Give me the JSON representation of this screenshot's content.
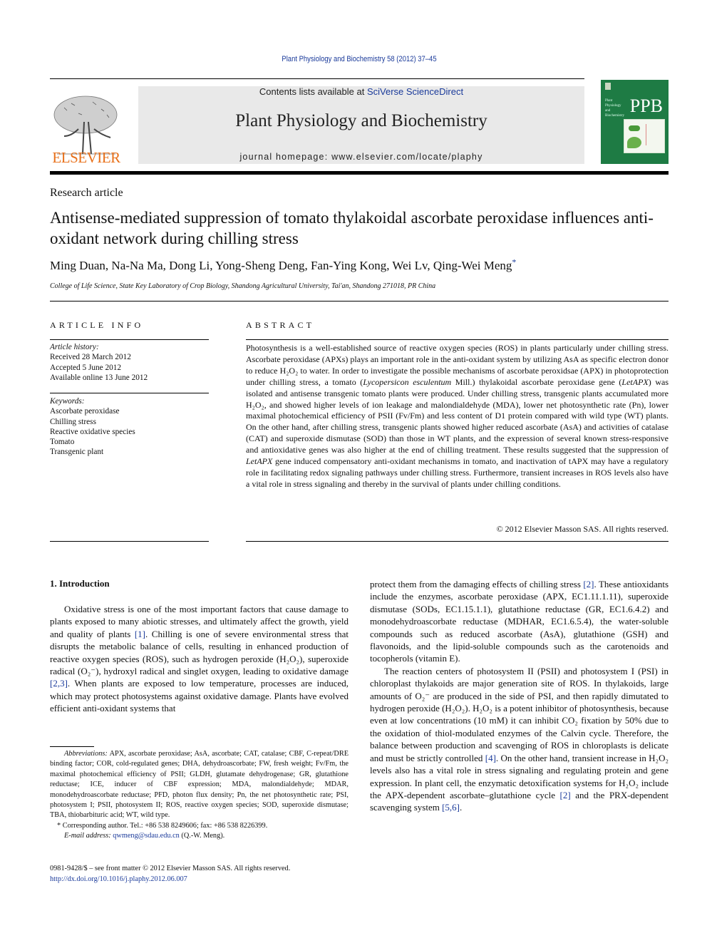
{
  "header": {
    "running_head": "Plant Physiology and Biochemistry 58 (2012) 37–45",
    "contents_prefix": "Contents lists available at ",
    "contents_link": "SciVerse ScienceDirect",
    "journal_name": "Plant Physiology and Biochemistry",
    "homepage_prefix": "journal homepage: ",
    "homepage_url": "www.elsevier.com/locate/plaphy",
    "publisher_logo_text": "ELSEVIER",
    "cover_title": "PPB",
    "cover_small_text": "Plant Physiology and Biochemistry",
    "colors": {
      "publisher_orange": "#e8701a",
      "cover_green": "#1e7b44",
      "link_blue": "#1a3a9a",
      "masthead_gray": "#e9e9e9"
    }
  },
  "article": {
    "type": "Research article",
    "title": "Antisense-mediated suppression of tomato thylakoidal ascorbate peroxidase influences anti-oxidant network during chilling stress",
    "authors": "Ming Duan, Na-Na Ma, Dong Li, Yong-Sheng Deng, Fan-Ying Kong, Wei Lv, Qing-Wei Meng",
    "corresponding_mark": "*",
    "affiliation": "College of Life Science, State Key Laboratory of Crop Biology, Shandong Agricultural University, Tai'an, Shandong 271018, PR China"
  },
  "article_info": {
    "heading": "ARTICLE INFO",
    "history_label": "Article history:",
    "history": [
      "Received 28 March 2012",
      "Accepted 5 June 2012",
      "Available online 13 June 2012"
    ],
    "keywords_label": "Keywords:",
    "keywords": [
      "Ascorbate peroxidase",
      "Chilling stress",
      "Reactive oxidative species",
      "Tomato",
      "Transgenic plant"
    ]
  },
  "abstract": {
    "heading": "ABSTRACT",
    "p1": "Photosynthesis is a well-established source of reactive oxygen species (ROS) in plants particularly under chilling stress. Ascorbate peroxidase (APXs) plays an important role in the anti-oxidant system by utilizing AsA as specific electron donor to reduce ",
    "h2o2": "H₂O₂",
    "p2": " to water. In order to investigate the possible mechanisms of ascorbate peroxidsae (APX) in photoprotection under chilling stress, a tomato (",
    "species": "Lycopersicon esculentum",
    "p3": " Mill.) thylakoidal ascorbate peroxidase gene (",
    "gene": "LetAPX",
    "p4": ") was isolated and antisense transgenic tomato plants were produced. Under chilling stress, transgenic plants accumulated more ",
    "p5": ", and showed higher levels of ion leakage and malondialdehyde (MDA), lower net photosynthetic rate (Pn), lower maximal photochemical efficiency of PSII (Fv/Fm) and less content of D1 protein compared with wild type (WT) plants. On the other hand, after chilling stress, transgenic plants showed higher reduced ascorbate (AsA) and activities of catalase (CAT) and superoxide dismutase (SOD) than those in WT plants, and the expression of several known stress-responsive and antioxidative genes was also higher at the end of chilling treatment. These results suggested that the suppression of ",
    "p6": " gene induced compensatory anti-oxidant mechanisms in tomato, and inactivation of tAPX may have a regulatory role in facilitating redox signaling pathways under chilling stress. Furthermore, transient increases in ROS levels also have a vital role in stress signaling and thereby in the survival of plants under chilling conditions.",
    "copyright": "© 2012 Elsevier Masson SAS. All rights reserved."
  },
  "introduction": {
    "heading": "1.  Introduction",
    "left_p1_a": "Oxidative stress is one of the most important factors that cause damage to plants exposed to many abiotic stresses, and ultimately affect the growth, yield and quality of plants ",
    "cite1": "[1]",
    "left_p1_b": ". Chilling is one of severe environmental stress that disrupts the metabolic balance of cells, resulting in enhanced production of reactive oxygen species (ROS), such as hydrogen peroxide (H₂O₂), superoxide radical (O₂⁻), hydroxyl radical and singlet oxygen, leading to oxidative damage ",
    "cite23": "[2,3]",
    "left_p1_c": ". When plants are exposed to low temperature, processes are induced, which may protect photosystems against oxidative damage. Plants have evolved efficient anti-oxidant systems that",
    "right_p1_a": "protect them from the damaging effects of chilling stress ",
    "cite2": "[2]",
    "right_p1_b": ". These antioxidants include the enzymes, ascorbate peroxidase (APX, EC1.11.1.11), superoxide dismutase (SODs, EC1.15.1.1), glutathione reductase (GR, EC1.6.4.2) and monodehydroascorbate reductase (MDHAR, EC1.6.5.4), the water-soluble compounds such as reduced ascorbate (AsA), glutathione (GSH) and flavonoids, and the lipid-soluble compounds such as the carotenoids and tocopherols (vitamin E).",
    "right_p2_a": "The reaction centers of photosystem II (PSII) and photosystem I (PSI) in chloroplast thylakoids are major generation site of ROS. In thylakoids, large amounts of O₂⁻ are produced in the side of PSI, and then rapidly dimutated to hydrogen peroxide (H₂O₂). H₂O₂ is a potent inhibitor of photosynthesis, because even at low concentrations (10 mM) it can inhibit CO₂ fixation by 50% due to the oxidation of thiol-modulated enzymes of the Calvin cycle. Therefore, the balance between production and scavenging of ROS in chloroplasts is delicate and must be strictly controlled ",
    "cite4": "[4]",
    "right_p2_b": ". On the other hand, transient increase in H₂O₂ levels also has a vital role in stress signaling and regulating protein and gene expression. In plant cell, the enzymatic detoxification systems for H₂O₂ include the APX-dependent ascorbate–glutathione cycle ",
    "cite2b": "[2]",
    "right_p2_c": " and the PRX-dependent scavenging system ",
    "cite56": "[5,6]",
    "right_p2_d": "."
  },
  "footnotes": {
    "abbr_label": "Abbreviations:",
    "abbr_text": " APX, ascorbate peroxidase; AsA, ascorbate; CAT, catalase; CBF, C-repeat/DRE binding factor; COR, cold-regulated genes; DHA, dehydroascorbate; FW, fresh weight; Fv/Fm, the maximal photochemical efficiency of PSII; GLDH, glutamate dehydrogenase; GR, glutathione reductase; ICE, inducer of CBF expression; MDA, malondialdehyde; MDAR, monodehydroascorbate reductase; PFD, photon flux density; Pn, the net photosynthetic rate; PSI, photosystem I; PSII, photosystem II; ROS, reactive oxygen species; SOD, superoxide dismutase; TBA, thiobarbituric acid; WT, wild type.",
    "corresponding": "* Corresponding author. Tel.: +86 538 8249606; fax: +86 538 8226399.",
    "email_label": "E-mail address: ",
    "email": "qwmeng@sdau.edu.cn",
    "email_suffix": " (Q.-W. Meng)."
  },
  "front_matter": {
    "issn_line": "0981-9428/$ – see front matter © 2012 Elsevier Masson SAS. All rights reserved.",
    "doi": "http://dx.doi.org/10.1016/j.plaphy.2012.06.007"
  }
}
